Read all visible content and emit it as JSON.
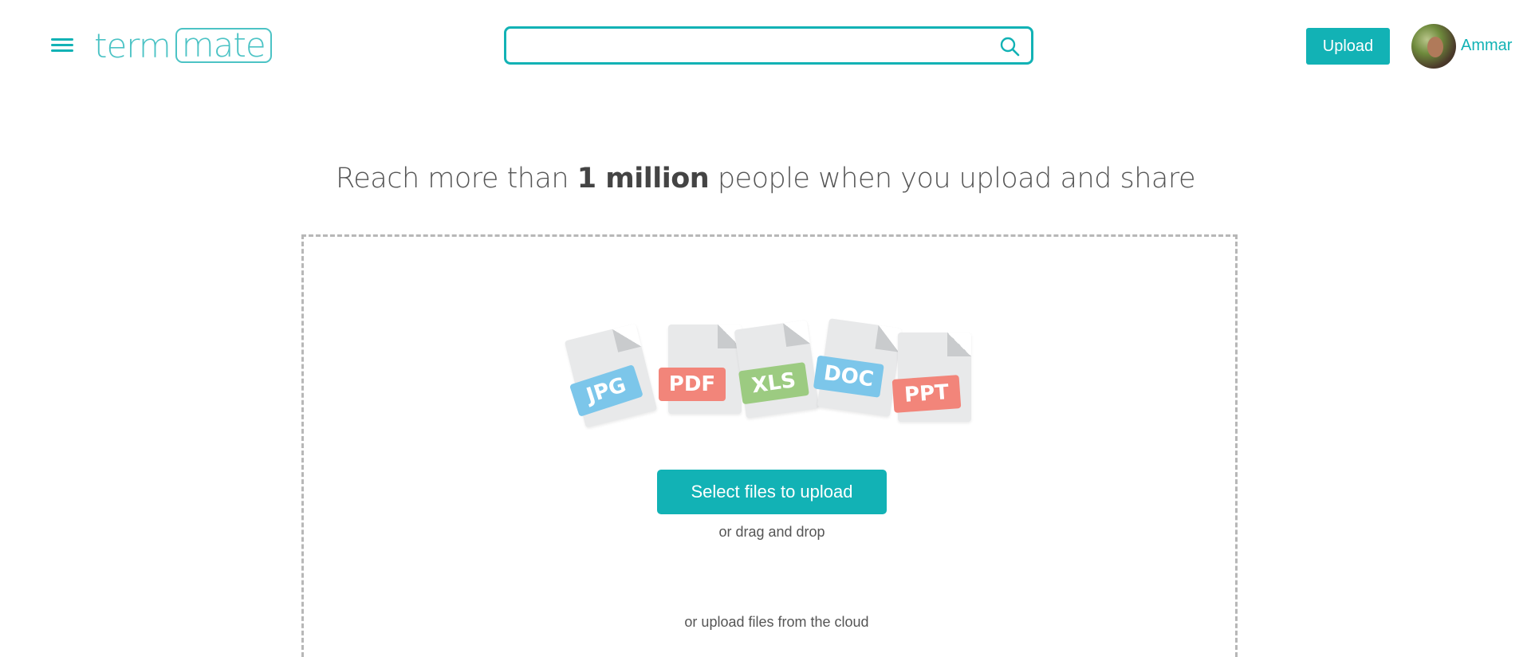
{
  "header": {
    "logo": {
      "left": "term",
      "right": "mate"
    },
    "search": {
      "value": "",
      "placeholder": ""
    },
    "upload_label": "Upload",
    "user_name": "Ammar"
  },
  "headline": {
    "prefix": "Reach more than ",
    "emphasis": "1 million",
    "suffix": " people when you upload and share"
  },
  "file_types": [
    "JPG",
    "PDF",
    "XLS",
    "DOC",
    "PPT"
  ],
  "upload_area": {
    "select_button_label": "Select files to upload",
    "drag_text": "or drag and drop",
    "cloud_text": "or upload files from the cloud"
  },
  "colors": {
    "accent": "#12b2b5",
    "tag_blue": "#7cc6ea",
    "tag_red": "#f2857a",
    "tag_green": "#9ccb81"
  },
  "icons": [
    "hamburger-menu-icon",
    "search-icon"
  ]
}
